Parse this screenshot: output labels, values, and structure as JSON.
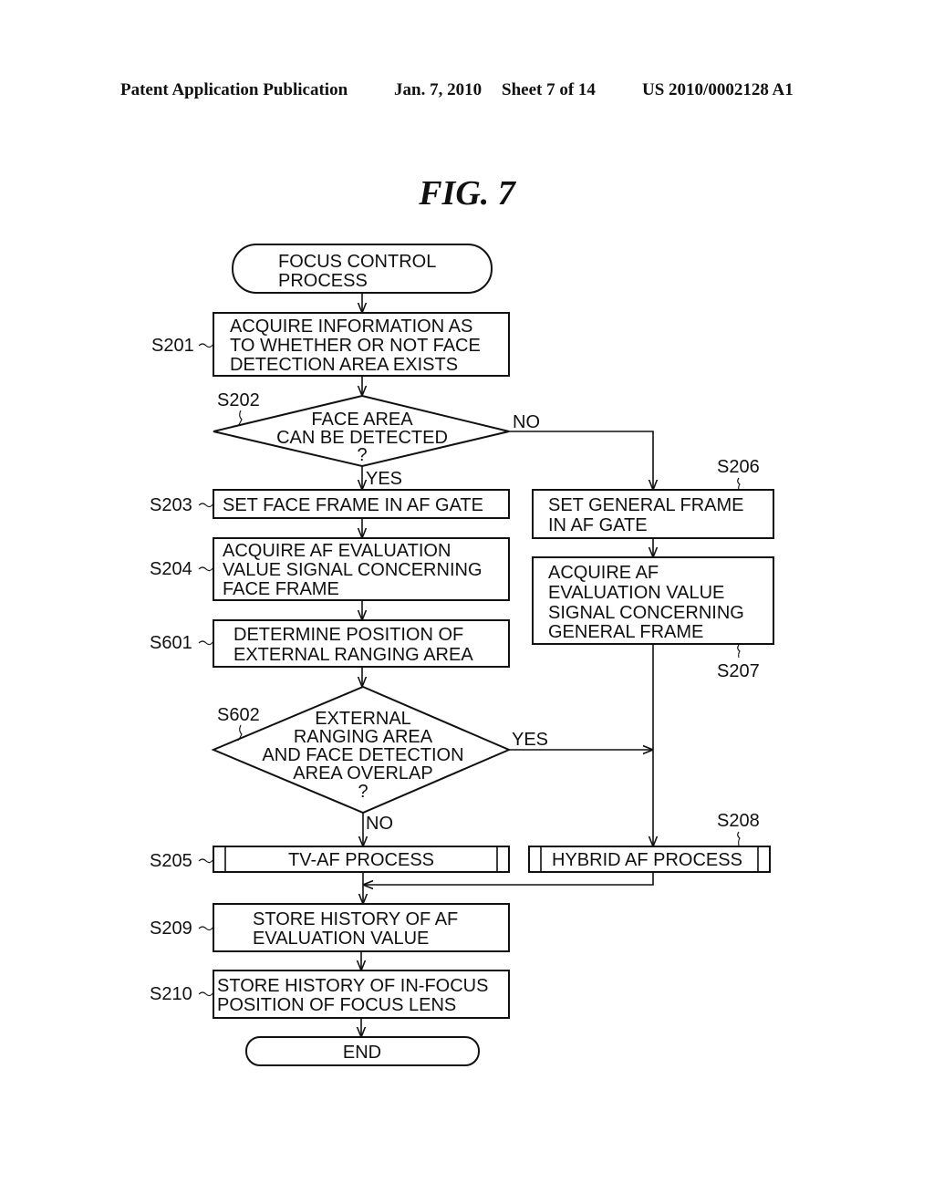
{
  "header": {
    "publication": "Patent Application Publication",
    "date": "Jan. 7, 2010",
    "sheet": "Sheet 7 of 14",
    "number": "US 2010/0002128 A1"
  },
  "figure_title": "FIG. 7",
  "nodes": {
    "start": {
      "lines": [
        "FOCUS CONTROL",
        "PROCESS"
      ]
    },
    "s201": {
      "label": "S201",
      "lines": [
        "ACQUIRE INFORMATION AS",
        "TO WHETHER OR NOT FACE",
        "DETECTION AREA EXISTS"
      ]
    },
    "s202": {
      "label": "S202",
      "lines": [
        "FACE AREA",
        "CAN BE DETECTED",
        "?"
      ]
    },
    "s203": {
      "label": "S203",
      "lines": [
        "SET FACE FRAME IN AF GATE"
      ]
    },
    "s204": {
      "label": "S204",
      "lines": [
        "ACQUIRE AF EVALUATION",
        "VALUE SIGNAL CONCERNING",
        "FACE FRAME"
      ]
    },
    "s601": {
      "label": "S601",
      "lines": [
        "DETERMINE POSITION OF",
        "EXTERNAL RANGING AREA"
      ]
    },
    "s602": {
      "label": "S602",
      "lines": [
        "EXTERNAL",
        "RANGING AREA",
        "AND FACE DETECTION",
        "AREA OVERLAP",
        "?"
      ]
    },
    "s205": {
      "label": "S205",
      "lines": [
        "TV-AF PROCESS"
      ]
    },
    "s206": {
      "label": "S206",
      "lines": [
        "SET GENERAL FRAME",
        "IN AF GATE"
      ]
    },
    "s207": {
      "label": "S207",
      "lines": [
        "ACQUIRE AF",
        "EVALUATION VALUE",
        "SIGNAL CONCERNING",
        "GENERAL FRAME"
      ]
    },
    "s208": {
      "label": "S208",
      "lines": [
        "HYBRID AF PROCESS"
      ]
    },
    "s209": {
      "label": "S209",
      "lines": [
        "STORE HISTORY OF AF",
        "EVALUATION VALUE"
      ]
    },
    "s210": {
      "label": "S210",
      "lines": [
        "STORE HISTORY OF IN-FOCUS",
        "POSITION OF FOCUS LENS"
      ]
    },
    "end": {
      "lines": [
        "END"
      ]
    }
  },
  "edge_labels": {
    "s202_no": "NO",
    "s202_yes": "YES",
    "s602_yes": "YES",
    "s602_no": "NO"
  }
}
